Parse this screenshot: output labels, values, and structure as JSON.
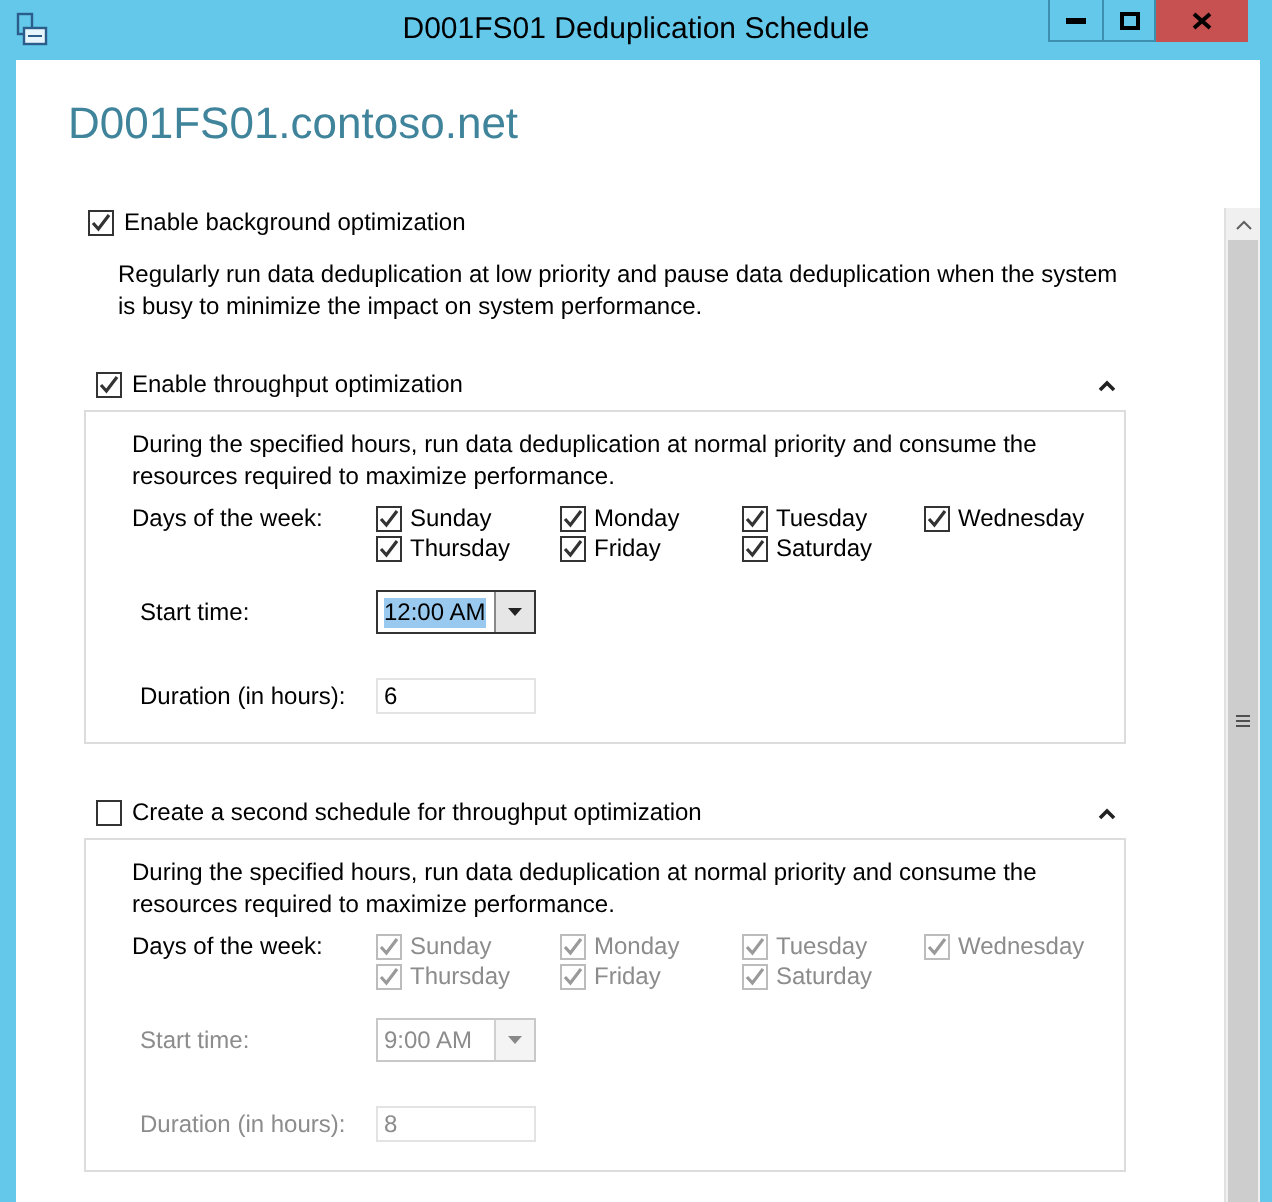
{
  "window": {
    "title": "D001FS01 Deduplication Schedule"
  },
  "heading": "D001FS01.contoso.net",
  "background": {
    "label": "Enable background optimization",
    "checked": true,
    "description": "Regularly run data deduplication at low priority and pause data deduplication when the system is busy to minimize the impact on system performance."
  },
  "schedules": [
    {
      "label": "Enable throughput optimization",
      "checked": true,
      "expanded": true,
      "disabled": false,
      "description": "During the specified hours, run data deduplication at normal priority and consume the resources required to maximize performance.",
      "days_label": "Days of the week:",
      "days": [
        {
          "label": "Sunday",
          "checked": true
        },
        {
          "label": "Monday",
          "checked": true
        },
        {
          "label": "Tuesday",
          "checked": true
        },
        {
          "label": "Wednesday",
          "checked": true
        },
        {
          "label": "Thursday",
          "checked": true
        },
        {
          "label": "Friday",
          "checked": true
        },
        {
          "label": "Saturday",
          "checked": true
        }
      ],
      "start_label": "Start time:",
      "start_time": "12:00 AM",
      "start_focused": true,
      "duration_label": "Duration (in hours):",
      "duration": "6"
    },
    {
      "label": "Create a second schedule for throughput optimization",
      "checked": false,
      "expanded": true,
      "disabled": true,
      "description": "During the specified hours, run data deduplication at normal priority and consume the resources required to maximize performance.",
      "days_label": "Days of the week:",
      "days": [
        {
          "label": "Sunday",
          "checked": true
        },
        {
          "label": "Monday",
          "checked": true
        },
        {
          "label": "Tuesday",
          "checked": true
        },
        {
          "label": "Wednesday",
          "checked": true
        },
        {
          "label": "Thursday",
          "checked": true
        },
        {
          "label": "Friday",
          "checked": true
        },
        {
          "label": "Saturday",
          "checked": true
        }
      ],
      "start_label": "Start time:",
      "start_time": "9:00 AM",
      "start_focused": false,
      "duration_label": "Duration (in hours):",
      "duration": "8"
    }
  ]
}
